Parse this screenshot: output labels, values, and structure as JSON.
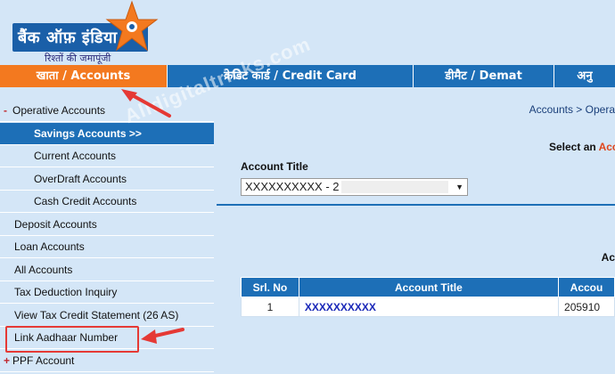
{
  "header": {
    "logo_text": "बैंक ऑफ़ इंडिया",
    "logo_tagline": "रिश्तों की जमापूंजी"
  },
  "topnav": [
    {
      "label": "खाता / Accounts",
      "active": true
    },
    {
      "label": "क्रेडिट कार्ड / Credit Card",
      "active": false
    },
    {
      "label": "डीमैट / Demat",
      "active": false
    },
    {
      "label": "अनु",
      "active": false
    }
  ],
  "sidebar": {
    "items": [
      {
        "prefix": "-",
        "label": "Operative Accounts"
      },
      {
        "label": "Savings Accounts >>",
        "selected": true
      },
      {
        "label": "Current Accounts"
      },
      {
        "label": "OverDraft Accounts"
      },
      {
        "label": "Cash Credit Accounts"
      },
      {
        "label": "Deposit Accounts"
      },
      {
        "label": "Loan Accounts"
      },
      {
        "label": "All Accounts"
      },
      {
        "label": "Tax Deduction Inquiry"
      },
      {
        "label": "View Tax Credit Statement (26 AS)"
      },
      {
        "label": "Link Aadhaar Number"
      },
      {
        "prefix": "+",
        "label": "PPF Account"
      }
    ]
  },
  "main": {
    "breadcrumb": "Accounts > Opera",
    "select_prefix": "Select an ",
    "select_accent": "Acc",
    "account_title_label": "Account Title",
    "account_select_value": "XXXXXXXXXX - 2",
    "ac_text": "Ac",
    "table": {
      "headers": [
        "Srl. No",
        "Account Title",
        "Accou"
      ],
      "rows": [
        [
          "1",
          "XXXXXXXXXX",
          "205910"
        ]
      ]
    }
  },
  "watermark": "Alldigitaltricks.com",
  "colors": {
    "brand_blue": "#1d6fb7",
    "brand_orange": "#f3791f",
    "background": "#d4e6f7",
    "annotation_red": "#e53935"
  }
}
